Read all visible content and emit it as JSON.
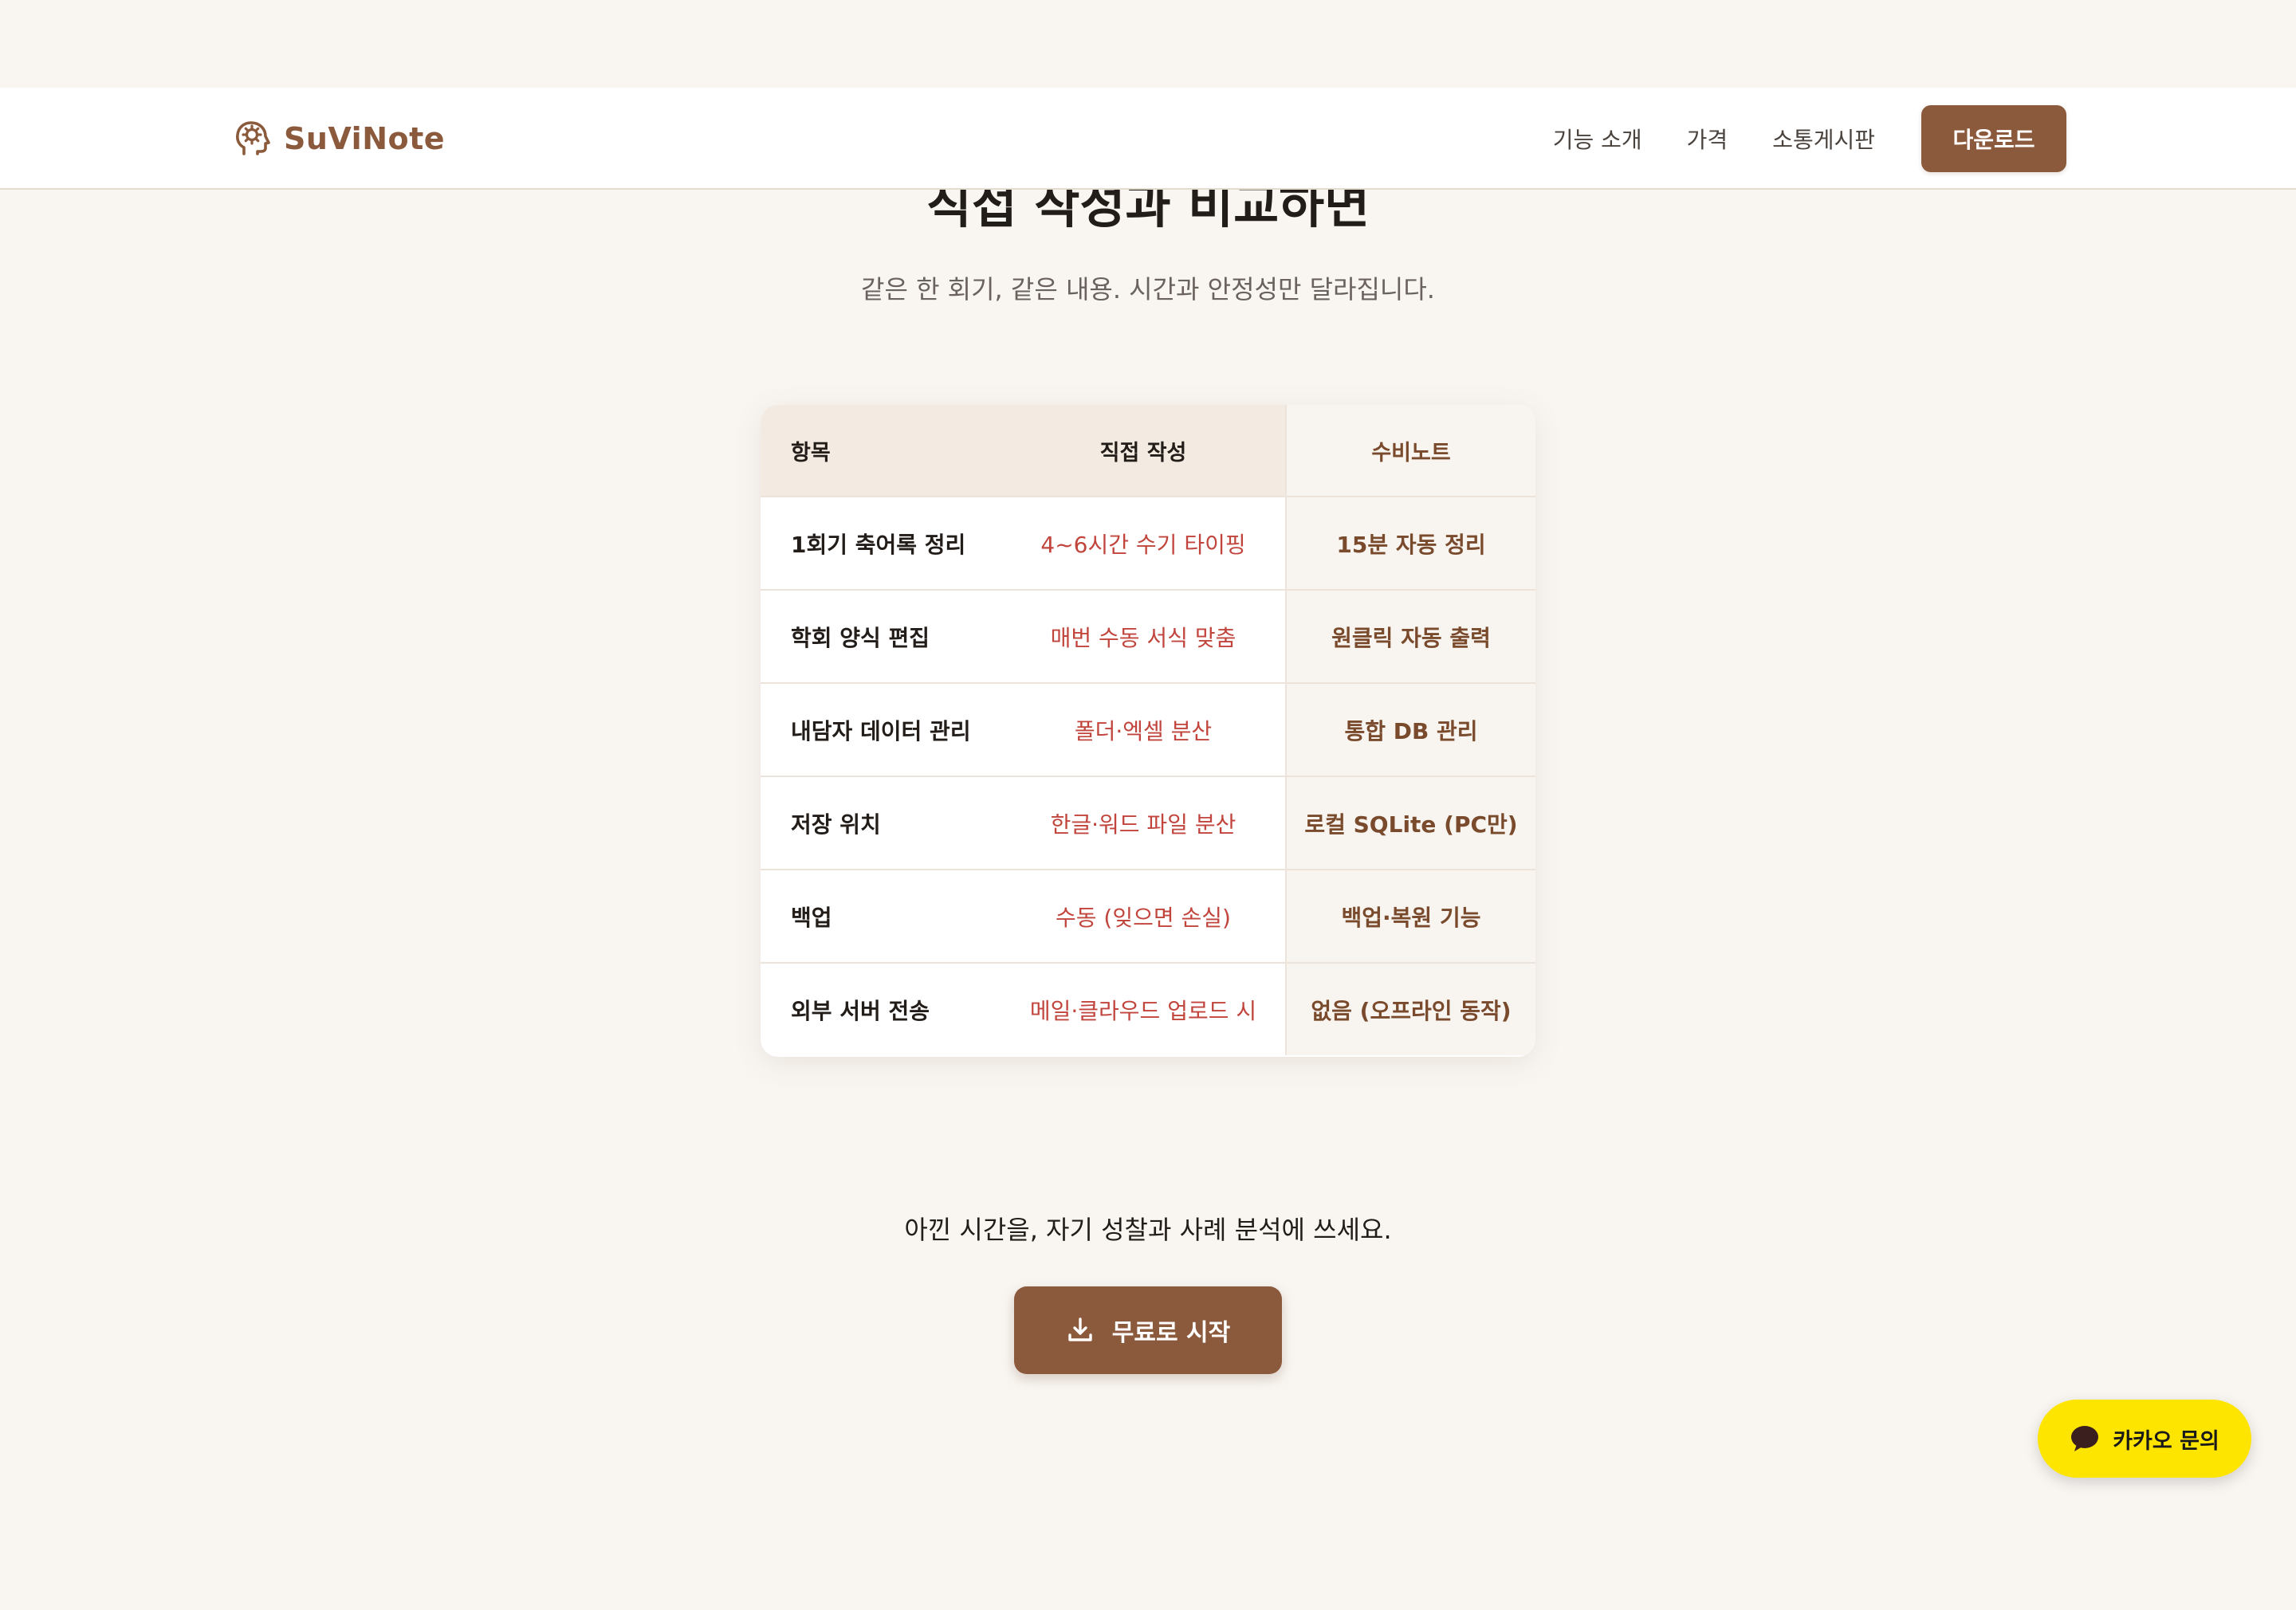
{
  "brand": {
    "name": "SuViNote",
    "logo_icon": "head-gear-icon",
    "color": "#8b5a3c"
  },
  "nav": {
    "items": [
      "기능 소개",
      "가격",
      "소통게시판"
    ],
    "cta": "다운로드"
  },
  "section": {
    "title": "직접 작성과 비교하면",
    "subtitle": "같은 한 회기, 같은 내용. 시간과 안정성만 달라집니다."
  },
  "comparison": {
    "headers": [
      "항목",
      "직접 작성",
      "수비노트"
    ],
    "rows": [
      {
        "item": "1회기 축어록 정리",
        "manual": "4~6시간 수기 타이핑",
        "suvinote": "15분 자동 정리"
      },
      {
        "item": "학회 양식 편집",
        "manual": "매번 수동 서식 맞춤",
        "suvinote": "원클릭 자동 출력"
      },
      {
        "item": "내담자 데이터 관리",
        "manual": "폴더·엑셀 분산",
        "suvinote": "통합 DB 관리"
      },
      {
        "item": "저장 위치",
        "manual": "한글·워드 파일 분산",
        "suvinote": "로컬 SQLite (PC만)"
      },
      {
        "item": "백업",
        "manual": "수동 (잊으면 손실)",
        "suvinote": "백업·복원 기능"
      },
      {
        "item": "외부 서버 전송",
        "manual": "메일·클라우드 업로드 시",
        "suvinote": "없음 (오프라인 동작)"
      }
    ]
  },
  "cta": {
    "text": "아낀 시간을, 자기 성찰과 사례 분석에 쓰세요.",
    "button": "무료로 시작",
    "button_icon": "download-icon"
  },
  "kakao": {
    "label": "카카오 문의",
    "icon": "chat-bubble-icon",
    "color": "#fee500"
  }
}
